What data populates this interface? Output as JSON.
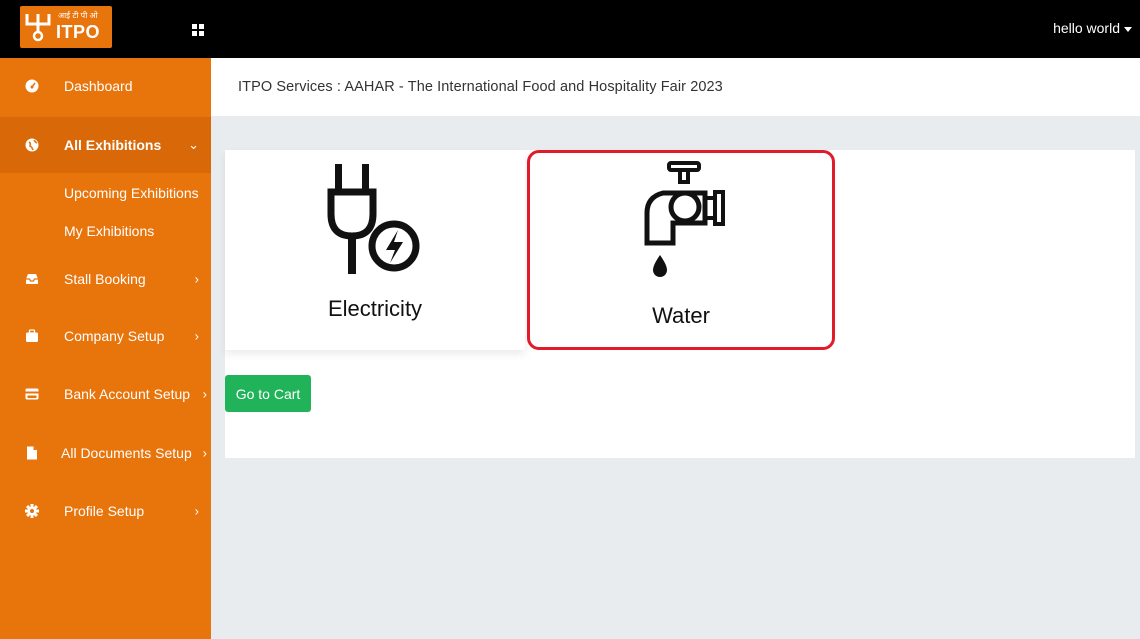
{
  "header": {
    "logo_small_text": "आई टी पी ओ",
    "logo_text": "ITPO",
    "user_label": "hello world"
  },
  "sidebar": {
    "items": [
      {
        "label": "Dashboard",
        "icon": "dashboard-gauge-icon"
      },
      {
        "label": "All Exhibitions",
        "icon": "globe-icon",
        "chevron": "⌄"
      },
      {
        "label": "Stall Booking",
        "icon": "inbox-icon",
        "chevron": "›"
      },
      {
        "label": "Company Setup",
        "icon": "briefcase-icon",
        "chevron": "›"
      },
      {
        "label": "Bank Account Setup",
        "icon": "credit-card-icon",
        "chevron": "›"
      },
      {
        "label": "All Documents Setup",
        "icon": "file-icon",
        "chevron": "›"
      },
      {
        "label": "Profile Setup",
        "icon": "gear-icon",
        "chevron": "›"
      }
    ],
    "sub_items": [
      {
        "label": "Upcoming Exhibitions"
      },
      {
        "label": "My Exhibitions"
      }
    ]
  },
  "main": {
    "breadcrumb": "ITPO Services : AAHAR - The International Food and Hospitality Fair 2023",
    "services": [
      {
        "label": "Electricity",
        "icon": "plug-electricity-icon"
      },
      {
        "label": "Water",
        "icon": "water-tap-icon"
      }
    ],
    "cart_button": "Go to Cart"
  },
  "colors": {
    "sidebar": "#e8740c",
    "topbar": "#000000",
    "highlight_border": "#e11b2a",
    "cart_button": "#21b35a"
  }
}
